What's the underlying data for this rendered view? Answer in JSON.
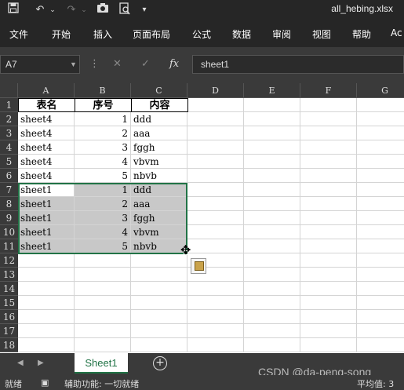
{
  "titlebar": {
    "icons": [
      "save-icon",
      "undo-icon",
      "dropdown-icon",
      "redo-icon",
      "dropdown-icon",
      "camera-icon",
      "print-preview-icon",
      "customize-icon"
    ],
    "filename": "all_hebing.xlsx"
  },
  "ribbon": {
    "tabs": [
      "文件",
      "开始",
      "插入",
      "页面布局",
      "公式",
      "数据",
      "审阅",
      "视图",
      "帮助",
      "Ac"
    ]
  },
  "formula_bar": {
    "name_box": "A7",
    "cancel": "✕",
    "enter": "✓",
    "fx": "fx",
    "value": "sheet1"
  },
  "grid": {
    "columns": [
      "A",
      "B",
      "C",
      "D",
      "E",
      "F",
      "G"
    ],
    "rows": [
      "1",
      "2",
      "3",
      "4",
      "5",
      "6",
      "7",
      "8",
      "9",
      "10",
      "11",
      "12",
      "13",
      "14",
      "15",
      "16",
      "17",
      "18"
    ],
    "header": [
      "表名",
      "序号",
      "内容"
    ],
    "data": [
      [
        "sheet4",
        "1",
        "ddd"
      ],
      [
        "sheet4",
        "2",
        "aaa"
      ],
      [
        "sheet4",
        "3",
        "fggh"
      ],
      [
        "sheet4",
        "4",
        "vbvm"
      ],
      [
        "sheet4",
        "5",
        "nbvb"
      ],
      [
        "sheet1",
        "1",
        "ddd"
      ],
      [
        "sheet1",
        "2",
        "aaa"
      ],
      [
        "sheet1",
        "3",
        "fggh"
      ],
      [
        "sheet1",
        "4",
        "vbvm"
      ],
      [
        "sheet1",
        "5",
        "nbvb"
      ]
    ],
    "selection": "A7:C11"
  },
  "sheets": {
    "active": "Sheet1",
    "add": "+"
  },
  "statusbar": {
    "mode": "就绪",
    "accessibility": "辅助功能: 一切就绪",
    "average": "平均值: 3"
  },
  "watermark": "CSDN @da-peng-song",
  "colors": {
    "accent": "#217346",
    "dark": "#262626",
    "panel": "#3a3a3a",
    "selection": "#c8c8c8"
  }
}
